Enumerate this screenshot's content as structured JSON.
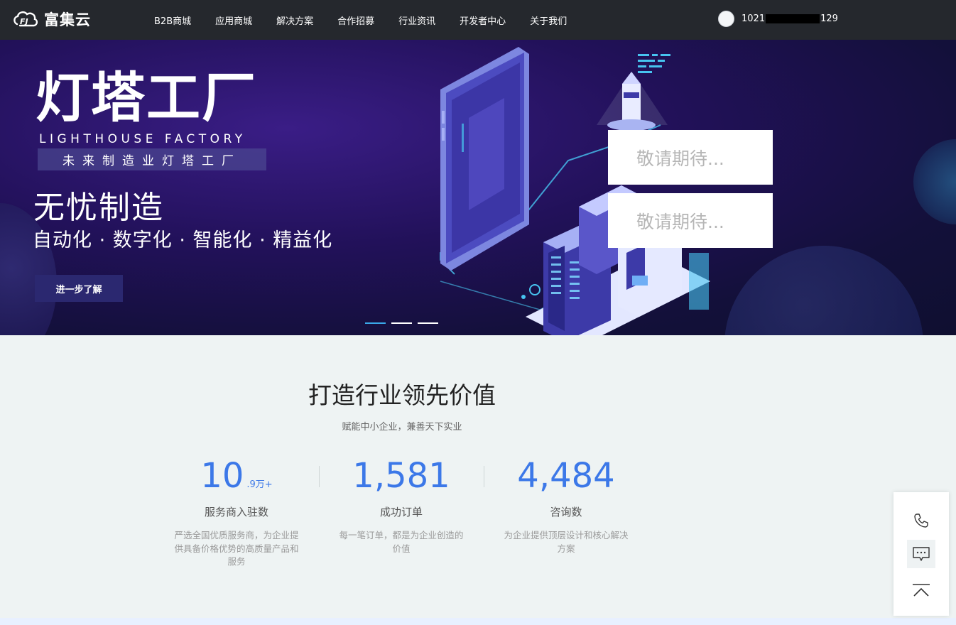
{
  "header": {
    "logo_text": "富集云",
    "nav": [
      {
        "label": "B2B商城"
      },
      {
        "label": "应用商城"
      },
      {
        "label": "解决方案"
      },
      {
        "label": "合作招募"
      },
      {
        "label": "行业资讯"
      },
      {
        "label": "开发者中心"
      },
      {
        "label": "关于我们"
      }
    ],
    "user": {
      "id_prefix": "1021",
      "id_suffix": "129"
    }
  },
  "hero": {
    "title": "灯塔工厂",
    "title_en": "LIGHTHOUSE FACTORY",
    "tagline": "未来制造业灯塔工厂",
    "subtitle": "无忧制造",
    "features": "自动化 · 数字化 · 智能化 · 精益化",
    "button_label": "进一步了解",
    "coming_cards": [
      "敬请期待...",
      "敬请期待..."
    ],
    "carousel": {
      "count": 3,
      "active_index": 0
    }
  },
  "value": {
    "title": "打造行业领先价值",
    "subtitle": "赋能中小企业，兼善天下实业",
    "stats": [
      {
        "number": "10",
        "unit": ".9万+",
        "label": "服务商入驻数",
        "desc": "严选全国优质服务商，为企业提供具备价格优势的高质量产品和服务"
      },
      {
        "number": "1,581",
        "unit": "",
        "label": "成功订单",
        "desc": "每一笔订单，都是为企业创造的价值"
      },
      {
        "number": "4,484",
        "unit": "",
        "label": "咨询数",
        "desc": "为企业提供顶层设计和核心解决方案"
      }
    ]
  },
  "colors": {
    "nav_bg": "#25282d",
    "accent_blue": "#3c78e8",
    "hero_bg": "#22115a",
    "dot_active": "#3aa8e8"
  },
  "icons": [
    "logo-icon",
    "phone-icon",
    "chat-icon",
    "back-to-top-icon"
  ]
}
